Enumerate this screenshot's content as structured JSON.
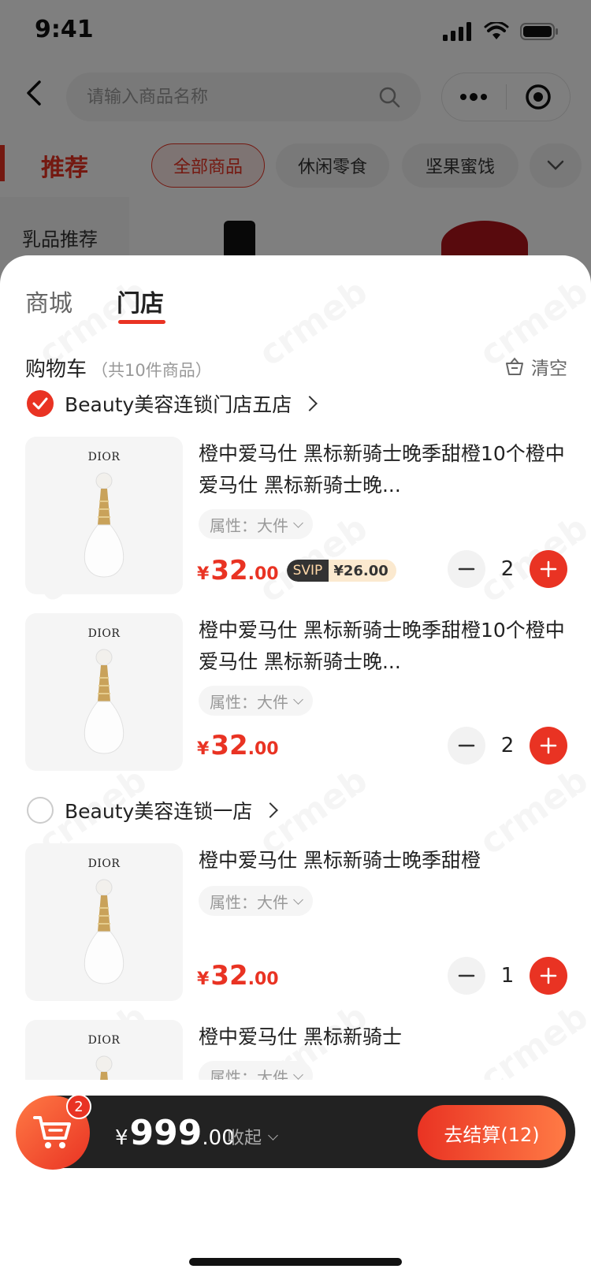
{
  "status_bar": {
    "time": "9:41"
  },
  "search": {
    "placeholder": "请输入商品名称"
  },
  "category": {
    "title": "推荐",
    "pills": [
      "全部商品",
      "休闲零食",
      "坚果蜜饯"
    ],
    "side_item": "乳品推荐"
  },
  "sheet": {
    "tabs": [
      "商城",
      "门店"
    ],
    "active_tab": "门店",
    "cart_title": "购物车",
    "cart_count": "（共10件商品）",
    "clear_label": "清空",
    "stores": [
      {
        "name": "Beauty美容连锁门店五店",
        "checked": true,
        "items": [
          {
            "brand": "DIOR",
            "name": "橙中爱马仕 黑标新骑士晚季甜橙10个橙中爱马仕 黑标新骑士晚...",
            "attr": "属性：大件",
            "price_yen": "¥",
            "price_int": "32",
            "price_dec": ".00",
            "svip_label": "SVIP",
            "svip_price": "¥26.00",
            "qty": "2"
          },
          {
            "brand": "DIOR",
            "name": "橙中爱马仕 黑标新骑士晚季甜橙10个橙中爱马仕 黑标新骑士晚...",
            "attr": "属性：大件",
            "price_yen": "¥",
            "price_int": "32",
            "price_dec": ".00",
            "qty": "2"
          }
        ]
      },
      {
        "name": "Beauty美容连锁一店",
        "checked": false,
        "items": [
          {
            "brand": "DIOR",
            "name": "橙中爱马仕 黑标新骑士晚季甜橙",
            "attr": "属性：大件",
            "price_yen": "¥",
            "price_int": "32",
            "price_dec": ".00",
            "qty": "1"
          },
          {
            "brand": "DIOR",
            "name": "橙中爱马仕 黑标新骑士",
            "attr": "属性：大件"
          }
        ]
      }
    ]
  },
  "bottom_bar": {
    "badge": "2",
    "total_yen": "¥",
    "total_int": "999",
    "total_dec": ".00",
    "collapse_label": "收起",
    "checkout_label": "去结算(12)"
  },
  "colors": {
    "accent": "#e93323",
    "dark_bar": "#222222",
    "gold": "#c9a25a"
  }
}
